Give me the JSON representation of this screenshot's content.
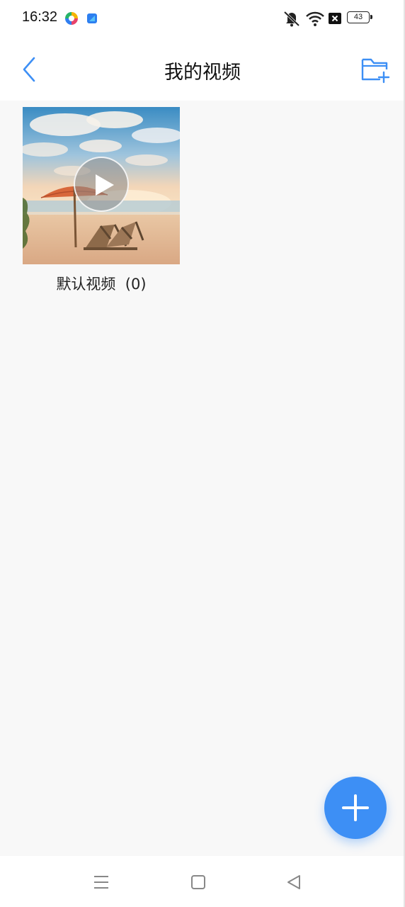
{
  "status_bar": {
    "time": "16:32",
    "battery_level": "43",
    "icons": [
      "colorful-app-icon",
      "blue-app-icon",
      "mute-icon",
      "wifi-icon",
      "sim-x-icon",
      "battery-icon"
    ]
  },
  "header": {
    "title": "我的视频",
    "back_icon": "chevron-left-icon",
    "action_icon": "folder-add-icon",
    "accent_color": "#3d8ff5"
  },
  "albums": [
    {
      "name": "默认视频",
      "count": "（0）",
      "label": "默认视频  (0)",
      "thumbnail": "beach-umbrella-scene"
    }
  ],
  "fab": {
    "icon": "plus-icon",
    "color": "#3d8ff5"
  },
  "nav_bar": {
    "icons": [
      "menu-icon",
      "home-icon",
      "back-triangle-icon"
    ]
  }
}
